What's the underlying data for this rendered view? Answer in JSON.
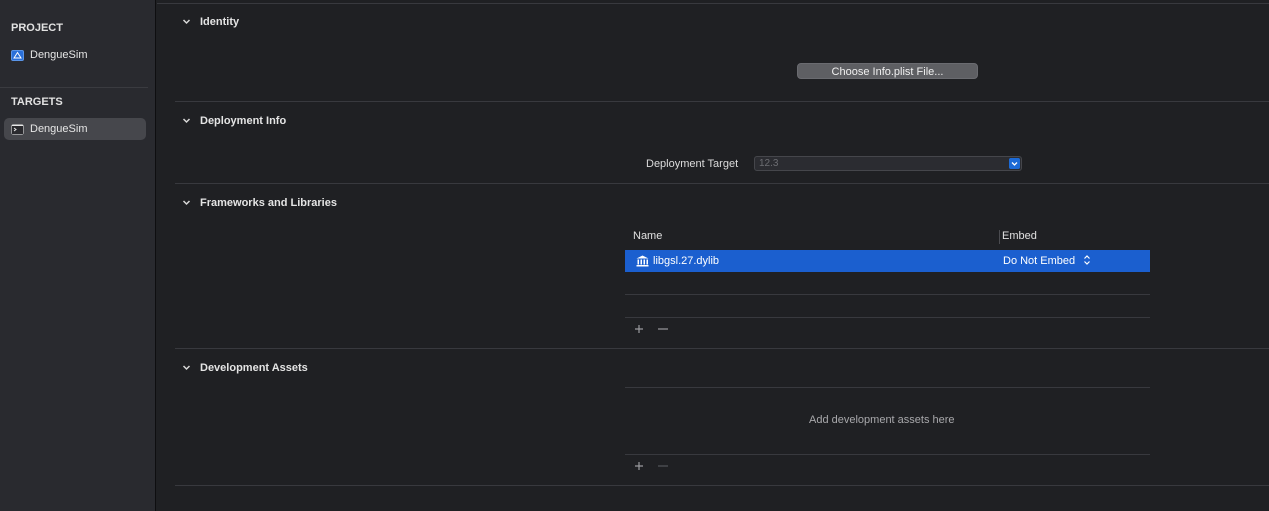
{
  "sidebar": {
    "project_heading": "PROJECT",
    "project_item": "DengueSim",
    "targets_heading": "TARGETS",
    "target_item": "DengueSim"
  },
  "sections": {
    "identity": "Identity",
    "deployment": "Deployment Info",
    "frameworks": "Frameworks and Libraries",
    "assets": "Development Assets"
  },
  "identity": {
    "choose_button": "Choose Info.plist File..."
  },
  "deployment": {
    "target_label": "Deployment Target",
    "target_value": "12.3"
  },
  "frameworks": {
    "columns": [
      "Name",
      "Embed"
    ],
    "rows": [
      {
        "name": "libgsl.27.dylib",
        "embed": "Do Not Embed"
      }
    ]
  },
  "assets": {
    "empty_text": "Add development assets here"
  },
  "colors": {
    "accent": "#1b5fcf",
    "background": "#1f2023",
    "sidebar": "#292a2f"
  }
}
